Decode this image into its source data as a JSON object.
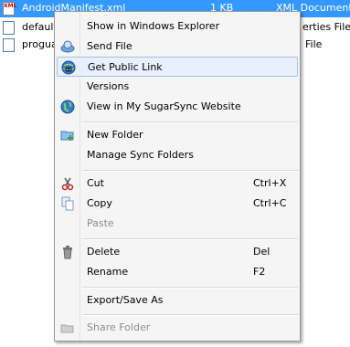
{
  "files": [
    {
      "name": "AndroidManifest.xml",
      "size": "1 KB",
      "type": "XML Document",
      "selected": true,
      "icon": "xml-file-icon"
    },
    {
      "name": "default",
      "size": "",
      "type": "erties File",
      "selected": false,
      "icon": "document-icon"
    },
    {
      "name": "progua",
      "size": "",
      "type": "File",
      "selected": false,
      "icon": "document-icon"
    }
  ],
  "menu": {
    "items": [
      {
        "label": "Show in Windows Explorer",
        "shortcut": "",
        "icon": "",
        "disabled": false
      },
      {
        "label": "Send File",
        "shortcut": "",
        "icon": "send-file-icon",
        "disabled": false
      },
      {
        "label": "Get Public Link",
        "shortcut": "",
        "icon": "public-link-icon",
        "disabled": false,
        "hover": true
      },
      {
        "label": "Versions",
        "shortcut": "",
        "icon": "",
        "disabled": false
      },
      {
        "label": "View in My SugarSync Website",
        "shortcut": "",
        "icon": "globe-icon",
        "disabled": false
      },
      {
        "label": "New Folder",
        "shortcut": "",
        "icon": "new-folder-icon",
        "disabled": false
      },
      {
        "label": "Manage Sync Folders",
        "shortcut": "",
        "icon": "",
        "disabled": false
      },
      {
        "label": "Cut",
        "shortcut": "Ctrl+X",
        "icon": "scissors-icon",
        "disabled": false
      },
      {
        "label": "Copy",
        "shortcut": "Ctrl+C",
        "icon": "copy-icon",
        "disabled": false
      },
      {
        "label": "Paste",
        "shortcut": "",
        "icon": "",
        "disabled": true
      },
      {
        "label": "Delete",
        "shortcut": "Del",
        "icon": "trash-icon",
        "disabled": false
      },
      {
        "label": "Rename",
        "shortcut": "F2",
        "icon": "",
        "disabled": false
      },
      {
        "label": "Export/Save As",
        "shortcut": "",
        "icon": "",
        "disabled": false
      },
      {
        "label": "Share Folder",
        "shortcut": "",
        "icon": "share-folder-icon",
        "disabled": true
      }
    ]
  },
  "colors": {
    "selection": "#3399ff",
    "menu_bg": "#f5f5f5",
    "hover_bg": "#e8f0fb",
    "hover_border": "#9fc2e9",
    "disabled_text": "#8d8d8d"
  }
}
